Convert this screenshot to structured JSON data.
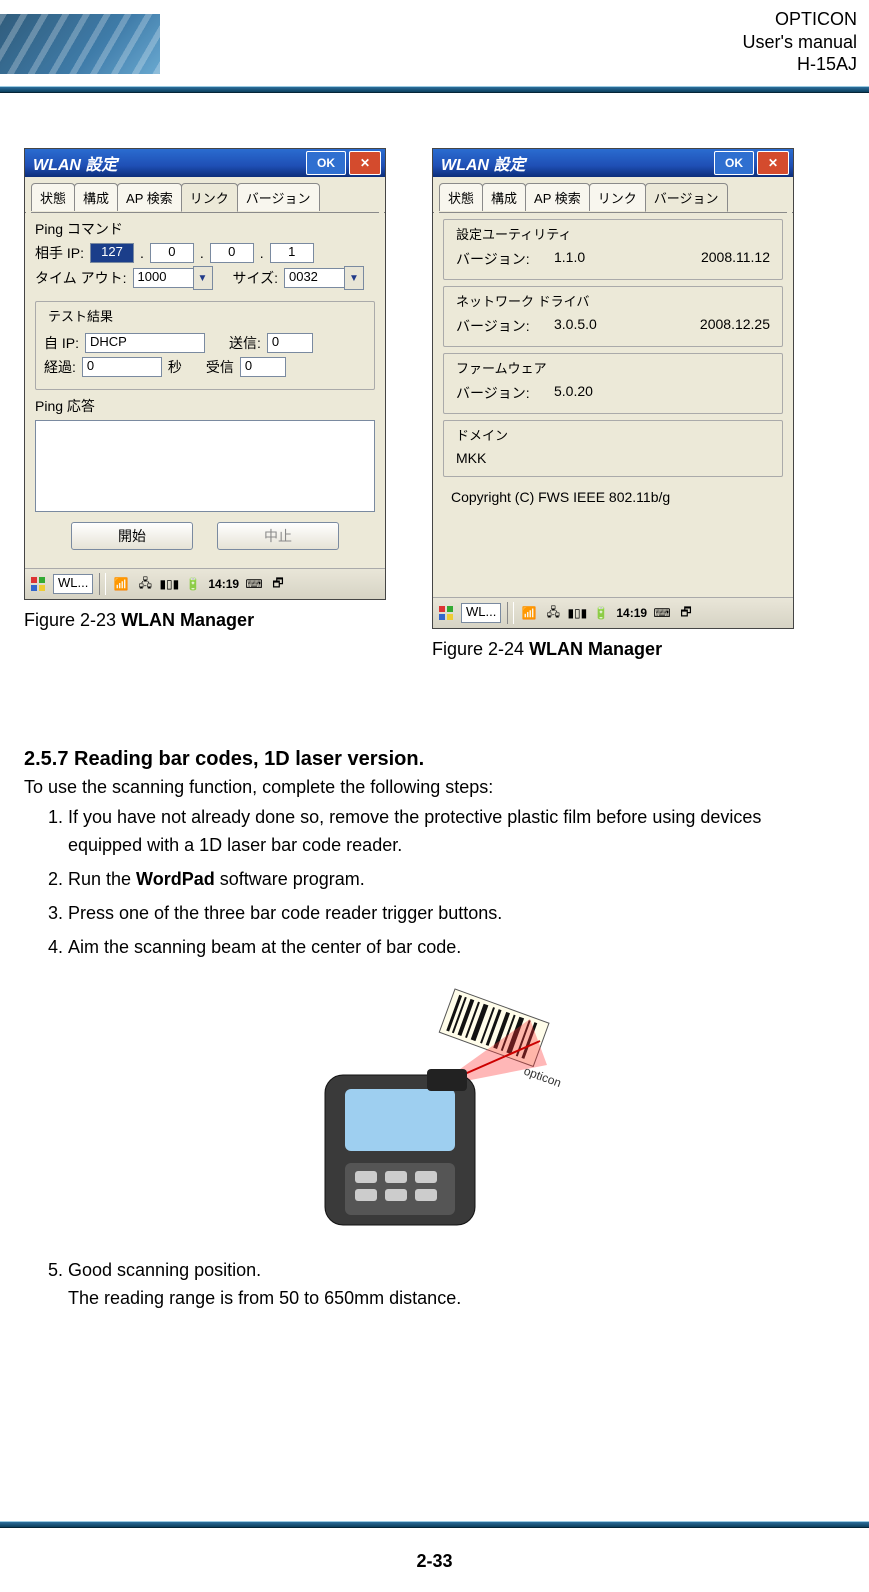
{
  "header": {
    "brand": "OPTICON",
    "doc": "User's manual",
    "model": "H-15AJ"
  },
  "captions": {
    "left": {
      "prefix": "Figure 2-23 ",
      "bold": "WLAN Manager"
    },
    "right": {
      "prefix": "Figure 2-24 ",
      "bold": "WLAN Manager"
    }
  },
  "shared": {
    "title": "WLAN 設定",
    "ok": "OK",
    "close": "✕",
    "tabs": [
      "状態",
      "構成",
      "AP 検索",
      "リンク",
      "バージョン"
    ],
    "task_app": "WL...",
    "clock": "14:19"
  },
  "left": {
    "active_tab": 3,
    "txt_ping_cmd": "Ping コマンド",
    "lbl_peer_ip": "相手 IP:",
    "ip": [
      "127",
      "0",
      "0",
      "1"
    ],
    "lbl_timeout": "タイム アウト:",
    "timeout_value": "1000",
    "lbl_size": "サイズ:",
    "size_value": "0032",
    "grp_test": "テスト結果",
    "lbl_self_ip": "自 IP:",
    "self_ip": "DHCP",
    "lbl_sent": "送信:",
    "sent": "0",
    "lbl_elapsed": "経過:",
    "elapsed": "0",
    "lbl_sec": "秒",
    "lbl_recv": "受信",
    "recv": "0",
    "lbl_ping_resp": "Ping 応答",
    "btn_start": "開始",
    "btn_stop": "中止"
  },
  "right": {
    "active_tab": 4,
    "g1_title": "設定ユーティリティ",
    "g1_vlbl": "バージョン:",
    "g1_ver": "1.1.0",
    "g1_date": "2008.11.12",
    "g2_title": "ネットワーク ドライバ",
    "g2_vlbl": "バージョン:",
    "g2_ver": "3.0.5.0",
    "g2_date": "2008.12.25",
    "g3_title": "ファームウェア",
    "g3_vlbl": "バージョン:",
    "g3_ver": "5.0.20",
    "g4_title": "ドメイン",
    "g4_val": "MKK",
    "copyright": "Copyright (C) FWS IEEE  802.11b/g"
  },
  "section": {
    "heading": "2.5.7 Reading bar codes, 1D laser version.",
    "lead": "To use the scanning function, complete the following steps:",
    "s1": "If you have not already done so, remove the protective plastic film before using devices equipped with a 1D laser bar code reader.",
    "s2a": "Run the ",
    "s2b": "WordPad",
    "s2c": " software program.",
    "s3": "Press one of the three bar code reader trigger buttons.",
    "s4": "Aim the scanning beam at the center of bar code.",
    "s5a": "Good scanning position.",
    "s5b": "The reading range is from 50 to 650mm distance."
  },
  "barcode_label": "opticon",
  "page_number": "2-33"
}
